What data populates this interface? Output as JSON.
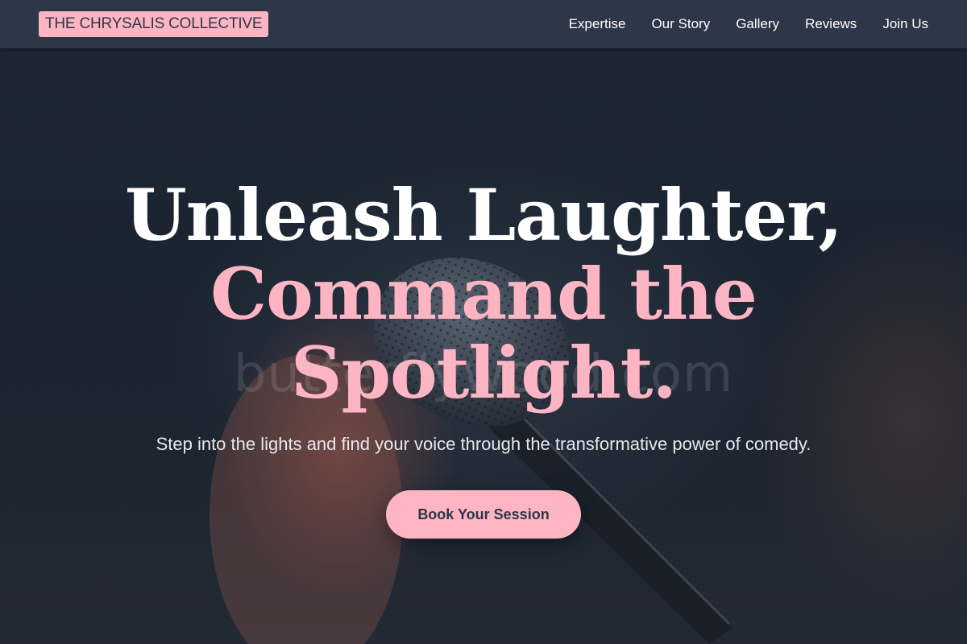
{
  "navbar": {
    "logo": "THE CHRYSALIS COLLECTIVE",
    "links": [
      "Expertise",
      "Our Story",
      "Gallery",
      "Reviews",
      "Join Us"
    ]
  },
  "hero": {
    "headline_line1": "Unleash Laughter,",
    "headline_line2": "Command the",
    "headline_line3": "Spotlight.",
    "subtitle": "Step into the lights and find your voice through the transformative power of comedy.",
    "cta_label": "Book Your Session",
    "watermark": "butterflywood.com"
  },
  "colors": {
    "accent_pink": "#fdb5c4",
    "nav_background": "#2d3748",
    "hero_background": "#1e2937"
  }
}
